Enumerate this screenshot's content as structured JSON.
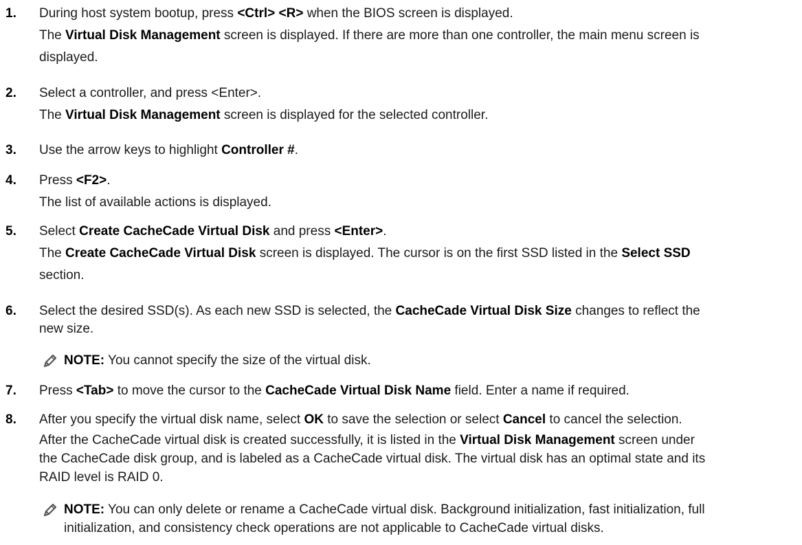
{
  "steps": [
    {
      "num": "1.",
      "l1": [
        "During host system bootup, press ",
        "<Ctrl> <R>",
        " when the BIOS screen is displayed."
      ],
      "l2": [
        "The ",
        "Virtual Disk Management",
        " screen is displayed. If there are more than one controller, the main menu screen is"
      ],
      "l3": "displayed."
    },
    {
      "num": "2.",
      "l1": "Select a controller, and press <Enter>.",
      "l2": [
        "The ",
        "Virtual Disk Management",
        " screen is displayed for the selected controller."
      ]
    },
    {
      "num": "3.",
      "l1": [
        "Use the arrow keys to highlight ",
        "Controller #",
        "."
      ]
    },
    {
      "num": "4.",
      "l1": [
        "Press ",
        "<F2>",
        "."
      ],
      "l2": "The list of available actions is displayed."
    },
    {
      "num": "5.",
      "l1": [
        "Select ",
        "Create CacheCade Virtual Disk",
        " and press ",
        "<Enter>",
        "."
      ],
      "l2": [
        "The ",
        "Create CacheCade Virtual Disk",
        " screen is displayed. The cursor is on the first SSD listed in the ",
        "Select SSD"
      ],
      "l3": "section."
    },
    {
      "num": "6.",
      "l1": [
        "Select the desired SSD(s). As each new SSD is selected, the ",
        "CacheCade Virtual Disk Size",
        " changes to reflect the"
      ],
      "l2": "new size.",
      "note": [
        "NOTE:",
        " You cannot specify the size of the virtual disk."
      ]
    },
    {
      "num": "7.",
      "l1": [
        "Press ",
        "<Tab>",
        " to move the cursor to the ",
        "CacheCade Virtual Disk Name",
        " field. Enter a name if required."
      ]
    },
    {
      "num": "8.",
      "l1": [
        "After you specify the virtual disk name, select ",
        "OK",
        " to save the selection or select ",
        "Cancel",
        " to cancel the selection."
      ],
      "l2": [
        "After the CacheCade virtual disk is created successfully, it is listed in the ",
        "Virtual Disk Management",
        " screen under"
      ],
      "l3": "the CacheCade disk group, and is labeled as a CacheCade virtual disk. The virtual disk has an optimal state and its",
      "l4": "RAID level is RAID 0.",
      "note": [
        "NOTE:",
        " You can only delete or rename a CacheCade virtual disk. Background initialization, fast initialization, full"
      ],
      "note2": "initialization, and consistency check operations are not applicable to CacheCade virtual disks."
    }
  ]
}
